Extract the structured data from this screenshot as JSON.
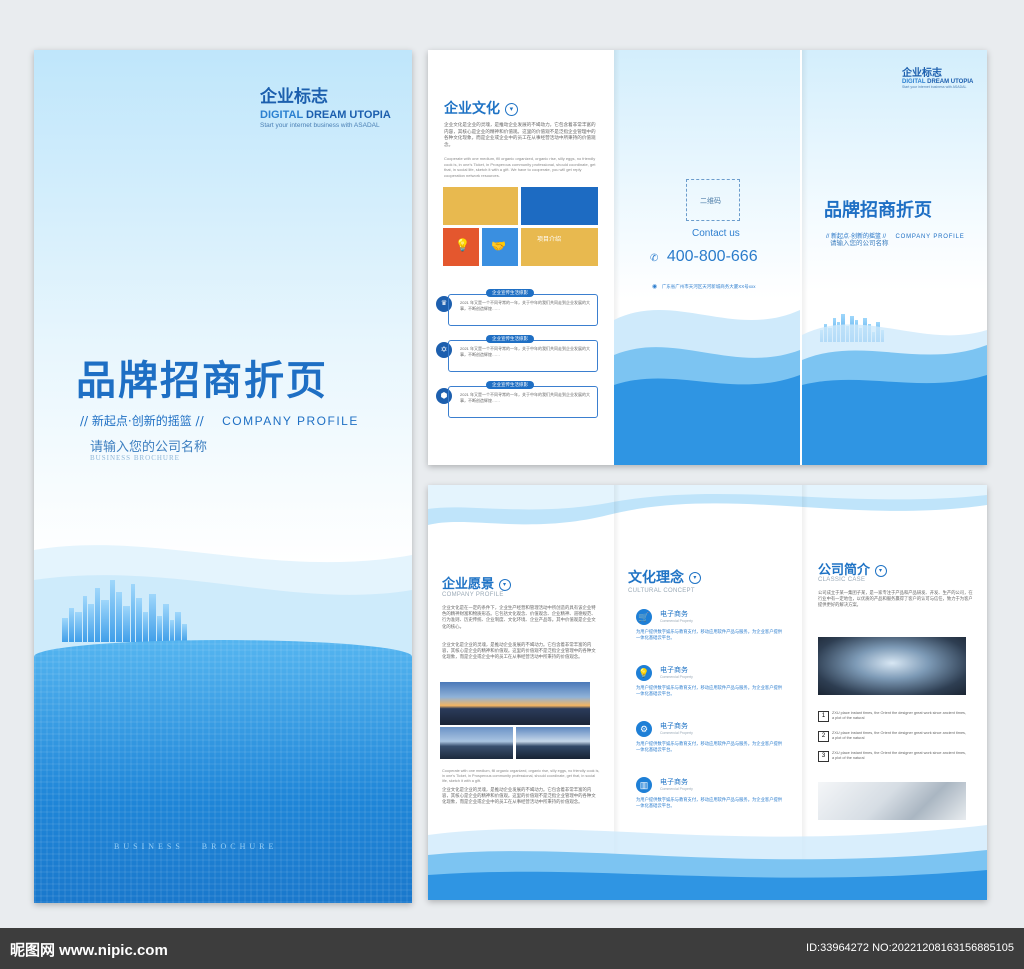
{
  "cover": {
    "logo_cn": "企业标志",
    "logo_en_part1": "DIGITAL ",
    "logo_en_part2": "DREAM UTOPIA",
    "logo_tagline": "Start your internet business with ASADAL",
    "title_cn": "品牌招商折页",
    "slogan": "// 新起点·创新的摇篮 //",
    "company_profile": "COMPANY PROFILE",
    "company_name": "请输入您的公司名称",
    "brochure_en": "BUSINESS BROCHURE",
    "footer_en": "BUSINESS   BROCHURE"
  },
  "culture_panel": {
    "title": "企业文化",
    "intro": "企业文化是企业的灵魂，是推动企业发展的不竭动力。它包含着非常丰富的内容，其核心是企业的精神和价值观。这里的价值观不是泛指企业管理中的各种文化现象，而是企业或企业中的员工在从事经营活动中所秉持的价值观念。",
    "intro_en": "Cooperate with one medium, fill organic organized, organic rise, silly eggs, no friendly cook is, in one's Ticket, in Prosperous community professional, should coordinate, get that, in social life, sketch it with a gift. We have to cooperate, you will get reply cooperation network resources.",
    "tile_text": "项目介绍",
    "timeline": [
      {
        "label": "企业宣传生活掠影",
        "text": "2021 年又是一个不同寻常的一年，关于中年的我们共同走到企业发展的大事，不断创造辉煌……"
      },
      {
        "label": "企业宣传生活掠影",
        "text": "2021 年又是一个不同寻常的一年，关于中年的我们共同走到企业发展的大事，不断创造辉煌……"
      },
      {
        "label": "企业宣传生活掠影",
        "text": "2021 年又是一个不同寻常的一年，关于中年的我们共同走到企业发展的大事，不断创造辉煌……"
      }
    ]
  },
  "contact_panel": {
    "qr_label": "二维码",
    "contact_us": "Contact us",
    "phone": "400-800-666",
    "address": "广东省广州市天河区天河新城商务大厦XX号xxx"
  },
  "back_cover": {
    "logo_cn": "企业标志",
    "logo_en_part1": "DIGITAL ",
    "logo_en_part2": "DREAM UTOPIA",
    "logo_tagline": "Start your internet business with ASADAL",
    "title_cn": "品牌招商折页",
    "slogan": "// 新起点·创新的摇篮 //",
    "company_profile": "COMPANY PROFILE",
    "company_name": "请输入您的公司名称"
  },
  "vision_panel": {
    "title": "企业愿景",
    "subtitle": "COMPANY PROFILE",
    "p1": "企业文化是在一定的条件下，企业生产经营和管理活动中所创造的具有该企业特色的精神财富和物质形态。它包括文化观念、价值观念、企业精神、道德规范、行为准则、历史传统、企业制度、文化环境、企业产品等。其中价值观是企业文化的核心。",
    "p2": "企业文化是企业的灵魂，是推动企业发展的不竭动力。它包含着非常丰富的内容，其核心是企业的精神和价值观。这里的价值观不是泛指企业管理中的各种文化现象，而是企业或企业中的员工在从事经营活动中所秉持的价值观念。",
    "en": "Cooperate with one medium, fill organic organized, organic rise, silly eggs, no friendly cook is, in one's Ticket, in Prosperous community professional, should coordinate, get that, in social life, sketch it with a gift.",
    "p3": "企业文化是企业的灵魂，是推动企业发展的不竭动力。它包含着非常丰富的内容，其核心是企业的精神和价值观。这里的价值观不是泛指企业管理中的各种文化现象，而是企业或企业中的员工在从事经营活动中所秉持的价值观念。"
  },
  "concept_panel": {
    "title": "文化理念",
    "subtitle": "CULTURAL CONCEPT",
    "items": [
      {
        "title": "电子商务",
        "en": "Commercial Property",
        "text": "为用户提供数字娱乐与教育支付，移动应用软件产品与服务。为企业客户提供一体化基础云平台。"
      },
      {
        "title": "电子商务",
        "en": "Commercial Property",
        "text": "为用户提供数字娱乐与教育支付，移动应用软件产品与服务。为企业客户提供一体化基础云平台。"
      },
      {
        "title": "电子商务",
        "en": "Commercial Property",
        "text": "为用户提供数字娱乐与教育支付，移动应用软件产品与服务。为企业客户提供一体化基础云平台。"
      },
      {
        "title": "电子商务",
        "en": "Commercial Property",
        "text": "为用户提供数字娱乐与教育支付，移动应用软件产品与服务。为企业客户提供一体化基础云平台。"
      }
    ]
  },
  "intro_panel": {
    "title": "公司简介",
    "subtitle": "CLASSIC CASE",
    "text": "公司成立于某一集团子某，是一家专注于产品和产品研发、开发、生产的公司，在行业中有一定地位，以优质的产品和服务赢得了客户的认可与信任，致力于为客户提供更好的解决方案。",
    "list": [
      {
        "num": "1",
        "text": "ZXU place instant times, the Orient the designer great work since ancient times, a plot of the natural"
      },
      {
        "num": "2",
        "text": "ZXU place instant times, the Orient the designer great work since ancient times, a plot of the natural"
      },
      {
        "num": "3",
        "text": "ZXU place instant times, the Orient the designer great work since ancient times, a plot of the natural"
      }
    ]
  },
  "watermark": {
    "site": "昵图网 www.nipic.com",
    "id": "ID:33964272 NO:20221208163156885105"
  },
  "colors": {
    "brand_blue": "#1f73c5",
    "sky_blue": "#3aa7ec",
    "tile_yellow": "#e8b94f",
    "tile_blue": "#1d6bc2",
    "tile_red": "#e4572e",
    "tile_light_blue": "#3a8fe0"
  }
}
